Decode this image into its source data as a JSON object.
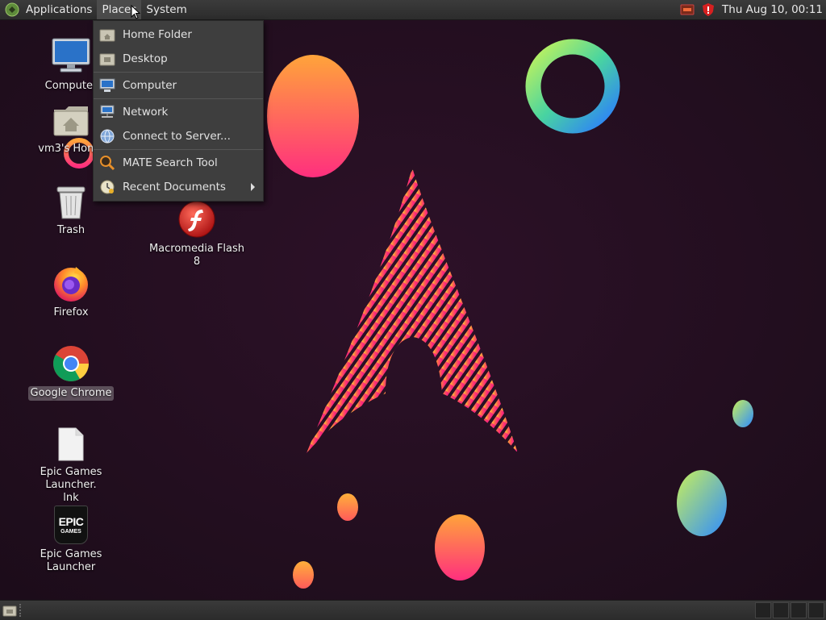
{
  "top_panel": {
    "menus": [
      {
        "label": "Applications"
      },
      {
        "label": "Places"
      },
      {
        "label": "System"
      }
    ],
    "clock": "Thu Aug 10, 00:11",
    "tray_icons": [
      "keyboard-layout-icon",
      "shield-icon"
    ]
  },
  "places_menu": {
    "items": [
      {
        "label": "Home Folder",
        "icon": "home-folder-icon"
      },
      {
        "label": "Desktop",
        "icon": "desktop-folder-icon"
      },
      {
        "label": "Computer",
        "icon": "computer-icon"
      },
      {
        "label": "Network",
        "icon": "network-icon"
      },
      {
        "label": "Connect to Server...",
        "icon": "globe-icon"
      },
      {
        "label": "MATE Search Tool",
        "icon": "search-icon"
      },
      {
        "label": "Recent Documents",
        "icon": "clock-icon",
        "has_submenu": true
      }
    ]
  },
  "desktop": {
    "icons": [
      {
        "label": "Computer",
        "icon": "computer-icon"
      },
      {
        "label": "vm3's Home",
        "icon": "home-folder-icon"
      },
      {
        "label": "Trash",
        "icon": "trash-icon"
      },
      {
        "label": "Firefox",
        "icon": "firefox-icon"
      },
      {
        "label": "Google Chrome",
        "icon": "chrome-icon",
        "selected": true
      },
      {
        "label": "Epic Games Launcher.\nlnk",
        "icon": "file-icon"
      },
      {
        "label": "Epic Games Launcher",
        "icon": "epic-games-icon"
      },
      {
        "label": "Macromedia Flash 8",
        "icon": "flash-icon"
      }
    ],
    "epic_logo_text": [
      "EPIC",
      "GAMES"
    ]
  },
  "colors": {
    "panel": "#2f2f2f",
    "menu_bg": "#3e3e3e",
    "wallpaper": "#231020",
    "accent_pink": "#ff2a7a",
    "accent_orange": "#ff9a3c"
  }
}
